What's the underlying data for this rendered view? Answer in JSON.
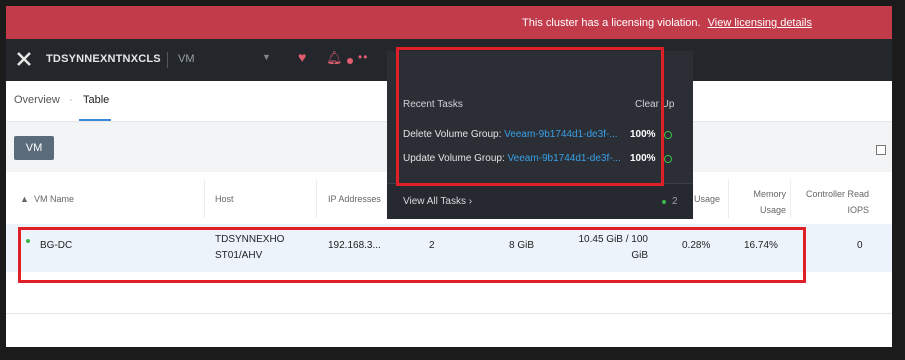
{
  "banner": {
    "message": "This cluster has a licensing violation.",
    "link": "View licensing details",
    "color": "#c23b4b"
  },
  "topbar": {
    "cluster_name": "TDSYNNEXNTNXCLS",
    "nav_label": "VM",
    "alert_dots": "••",
    "task_count": "2"
  },
  "subnav": {
    "tabs": [
      {
        "label": "Overview"
      },
      {
        "label": "Table"
      }
    ],
    "separator": "·"
  },
  "actionbar": {
    "vm_button": "VM"
  },
  "table": {
    "columns": [
      "VM Name",
      "Host",
      "IP Addresses",
      "Usage",
      "Memory Usage",
      "Controller Read IOPS"
    ],
    "rows": [
      {
        "name": "BG-DC",
        "host": "TDSYNNEXHOST01/AHV",
        "ip": "192.168.3...",
        "cores": "2",
        "memory": "8 GiB",
        "storage": "10.45 GiB / 100 GiB",
        "cpu": "0.28%",
        "mem_usage": "16.74%",
        "iops": "0"
      }
    ]
  },
  "tasks_panel": {
    "title": "Recent Tasks",
    "clear_label": "Clear Up",
    "tasks": [
      {
        "name": "Delete Volume Group: ",
        "target": "Veeam-9b1744d1-de3f-...",
        "progress": "100%"
      },
      {
        "name": "Update Volume Group: ",
        "target": "Veeam-9b1744d1-de3f-...",
        "progress": "100%"
      }
    ],
    "view_all": "View All Tasks ›",
    "count": "2"
  },
  "colors": {
    "accent": "#3a8ad8",
    "success": "#3bb54a",
    "highlight": "#e11f26"
  }
}
